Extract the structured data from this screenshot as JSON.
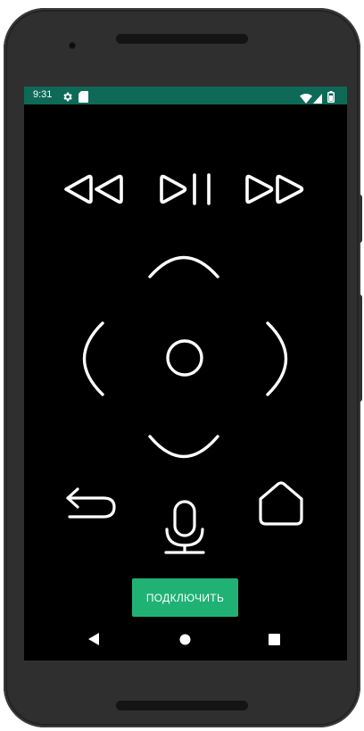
{
  "status_bar": {
    "time": "9:31",
    "icons_left": [
      "gear-icon",
      "sd-card-icon"
    ],
    "icons_right": [
      "wifi-icon",
      "signal-icon",
      "battery-icon"
    ],
    "background_color": "#0e6a57"
  },
  "remote": {
    "media_buttons": [
      "rewind-icon",
      "play-pause-icon",
      "fast-forward-icon"
    ],
    "dpad": [
      "dpad-up-icon",
      "dpad-left-icon",
      "dpad-center-icon",
      "dpad-right-icon",
      "dpad-down-icon"
    ],
    "bottom_buttons": [
      "back-icon",
      "microphone-icon",
      "home-icon"
    ],
    "connect_button_label": "ПОДКЛЮЧИТЬ",
    "accent_color": "#1fb274"
  },
  "nav_bar": {
    "items": [
      "nav-back-icon",
      "nav-home-icon",
      "nav-recents-icon"
    ]
  }
}
